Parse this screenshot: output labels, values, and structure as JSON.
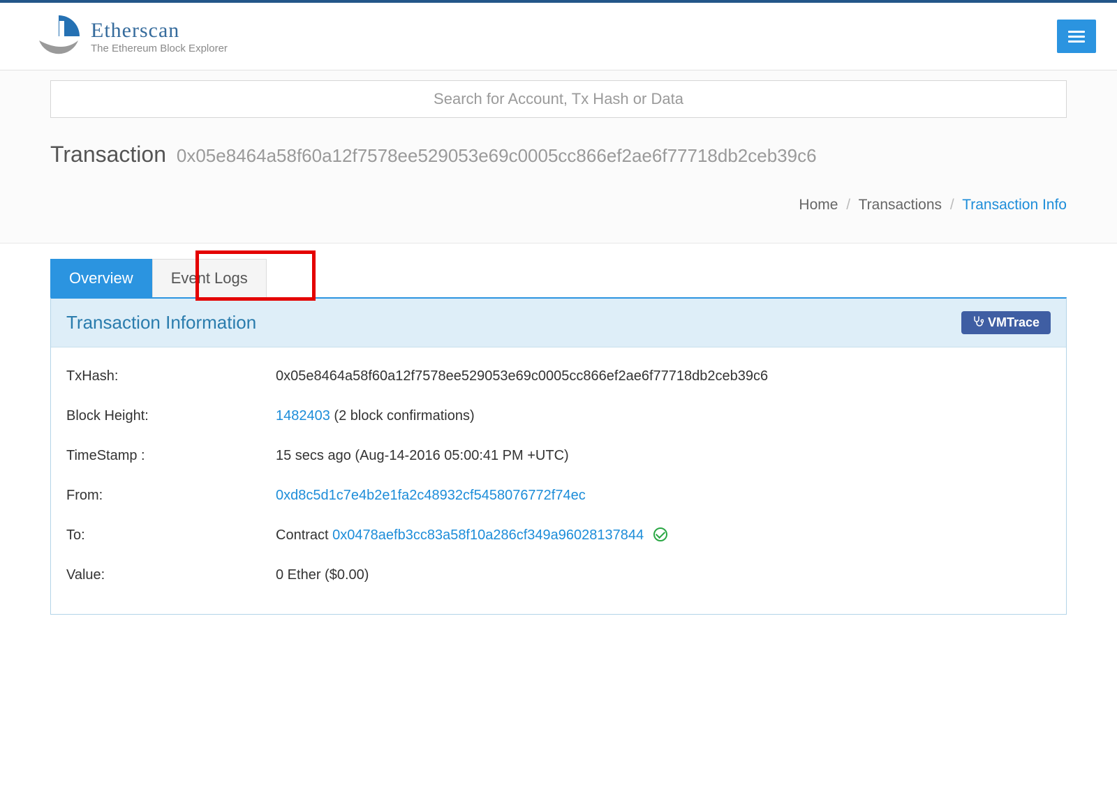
{
  "logo": {
    "title": "Etherscan",
    "sub": "The Ethereum Block Explorer"
  },
  "search": {
    "placeholder": "Search for Account, Tx Hash or Data"
  },
  "page": {
    "title": "Transaction",
    "hash_display": "0x05e8464a58f60a12f7578ee529053e69c0005cc866ef2ae6f77718db2ceb39c6"
  },
  "breadcrumb": {
    "home": "Home",
    "transactions": "Transactions",
    "info": "Transaction Info"
  },
  "tabs": {
    "overview": "Overview",
    "eventlogs": "Event Logs"
  },
  "panel": {
    "title": "Transaction Information",
    "vmtrace": "VMTrace"
  },
  "tx": {
    "txhash_label": "TxHash:",
    "txhash_value": "0x05e8464a58f60a12f7578ee529053e69c0005cc866ef2ae6f77718db2ceb39c6",
    "blockheight_label": "Block Height:",
    "blockheight_link": "1482403",
    "blockheight_suffix": " (2 block confirmations)",
    "timestamp_label": "TimeStamp :",
    "timestamp_value": "15 secs ago (Aug-14-2016 05:00:41 PM +UTC)",
    "from_label": "From:",
    "from_value": "0xd8c5d1c7e4b2e1fa2c48932cf5458076772f74ec",
    "to_label": "To:",
    "to_prefix": "Contract ",
    "to_value": "0x0478aefb3cc83a58f10a286cf349a96028137844",
    "value_label": "Value:",
    "value_value": "0 Ether ($0.00)"
  }
}
